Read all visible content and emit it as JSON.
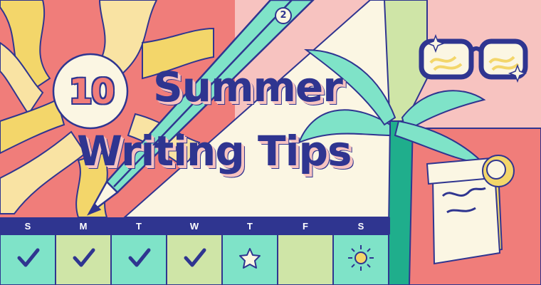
{
  "badge": {
    "number": "10"
  },
  "title": {
    "line1": "Summer",
    "line2": "Writing Tips"
  },
  "pencil": {
    "mark": "2"
  },
  "calendar": {
    "days": [
      {
        "label": "S",
        "mark": "check-icon"
      },
      {
        "label": "M",
        "mark": "check-icon"
      },
      {
        "label": "T",
        "mark": "check-icon"
      },
      {
        "label": "W",
        "mark": "check-icon"
      },
      {
        "label": "T",
        "mark": "star-icon"
      },
      {
        "label": "F",
        "mark": "none"
      },
      {
        "label": "S",
        "mark": "sun-icon"
      }
    ]
  },
  "colors": {
    "navy": "#2f3590",
    "coral": "#f07d7a",
    "pink": "#f7c3c0",
    "mint": "#7fe3c8",
    "yellow": "#f3d66a",
    "cream": "#fbf6e3",
    "green": "#1fae8c"
  }
}
